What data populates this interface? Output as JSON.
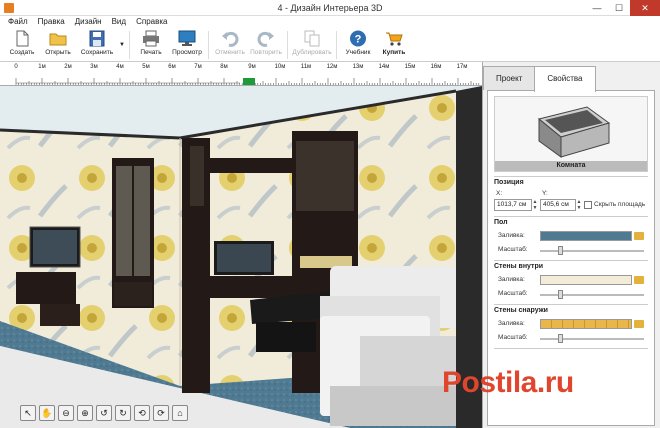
{
  "window": {
    "title": "4 - Дизайн Интерьера 3D",
    "minimize": "—",
    "maximize": "☐",
    "close": "✕"
  },
  "menu": [
    "Файл",
    "Правка",
    "Дизайн",
    "Вид",
    "Справка"
  ],
  "toolbar": {
    "create": "Создать",
    "open": "Открыть",
    "save": "Сохранить",
    "print": "Печать",
    "preview": "Просмотр",
    "undo": "Отменить",
    "redo": "Повторить",
    "duplicate": "Дублировать",
    "tutorial": "Учебник",
    "buy": "Купить"
  },
  "ruler": {
    "labels": [
      "1м",
      "2м",
      "3м",
      "4м",
      "5м",
      "6м",
      "7м",
      "8м",
      "9м",
      "10м",
      "11м",
      "12м",
      "13м",
      "14м",
      "15м",
      "16м",
      "17м"
    ],
    "first": "0"
  },
  "panel": {
    "tabs": [
      "Проект",
      "Свойства"
    ],
    "object_name": "Комната",
    "position": {
      "title": "Позиция",
      "x_label": "X:",
      "y_label": "Y:",
      "x_value": "1013,7 см",
      "y_value": "405,6 см",
      "hide_area": "Скрыть площадь"
    },
    "floor": {
      "title": "Пол",
      "fill_label": "Заливка:",
      "scale_label": "Масштаб:"
    },
    "walls_inside": {
      "title": "Стены внутри",
      "fill_label": "Заливка:",
      "scale_label": "Масштаб:"
    },
    "walls_outside": {
      "title": "Стены снаружи",
      "fill_label": "Заливка:",
      "scale_label": "Масштаб:"
    }
  },
  "watermark": "Postila.ru",
  "colors": {
    "floor": "#4f7a92",
    "wall_pattern": "#f2ecd8",
    "brick": "#e8b64a",
    "furniture": "#231a17",
    "sofa": "#e8e8e8"
  }
}
